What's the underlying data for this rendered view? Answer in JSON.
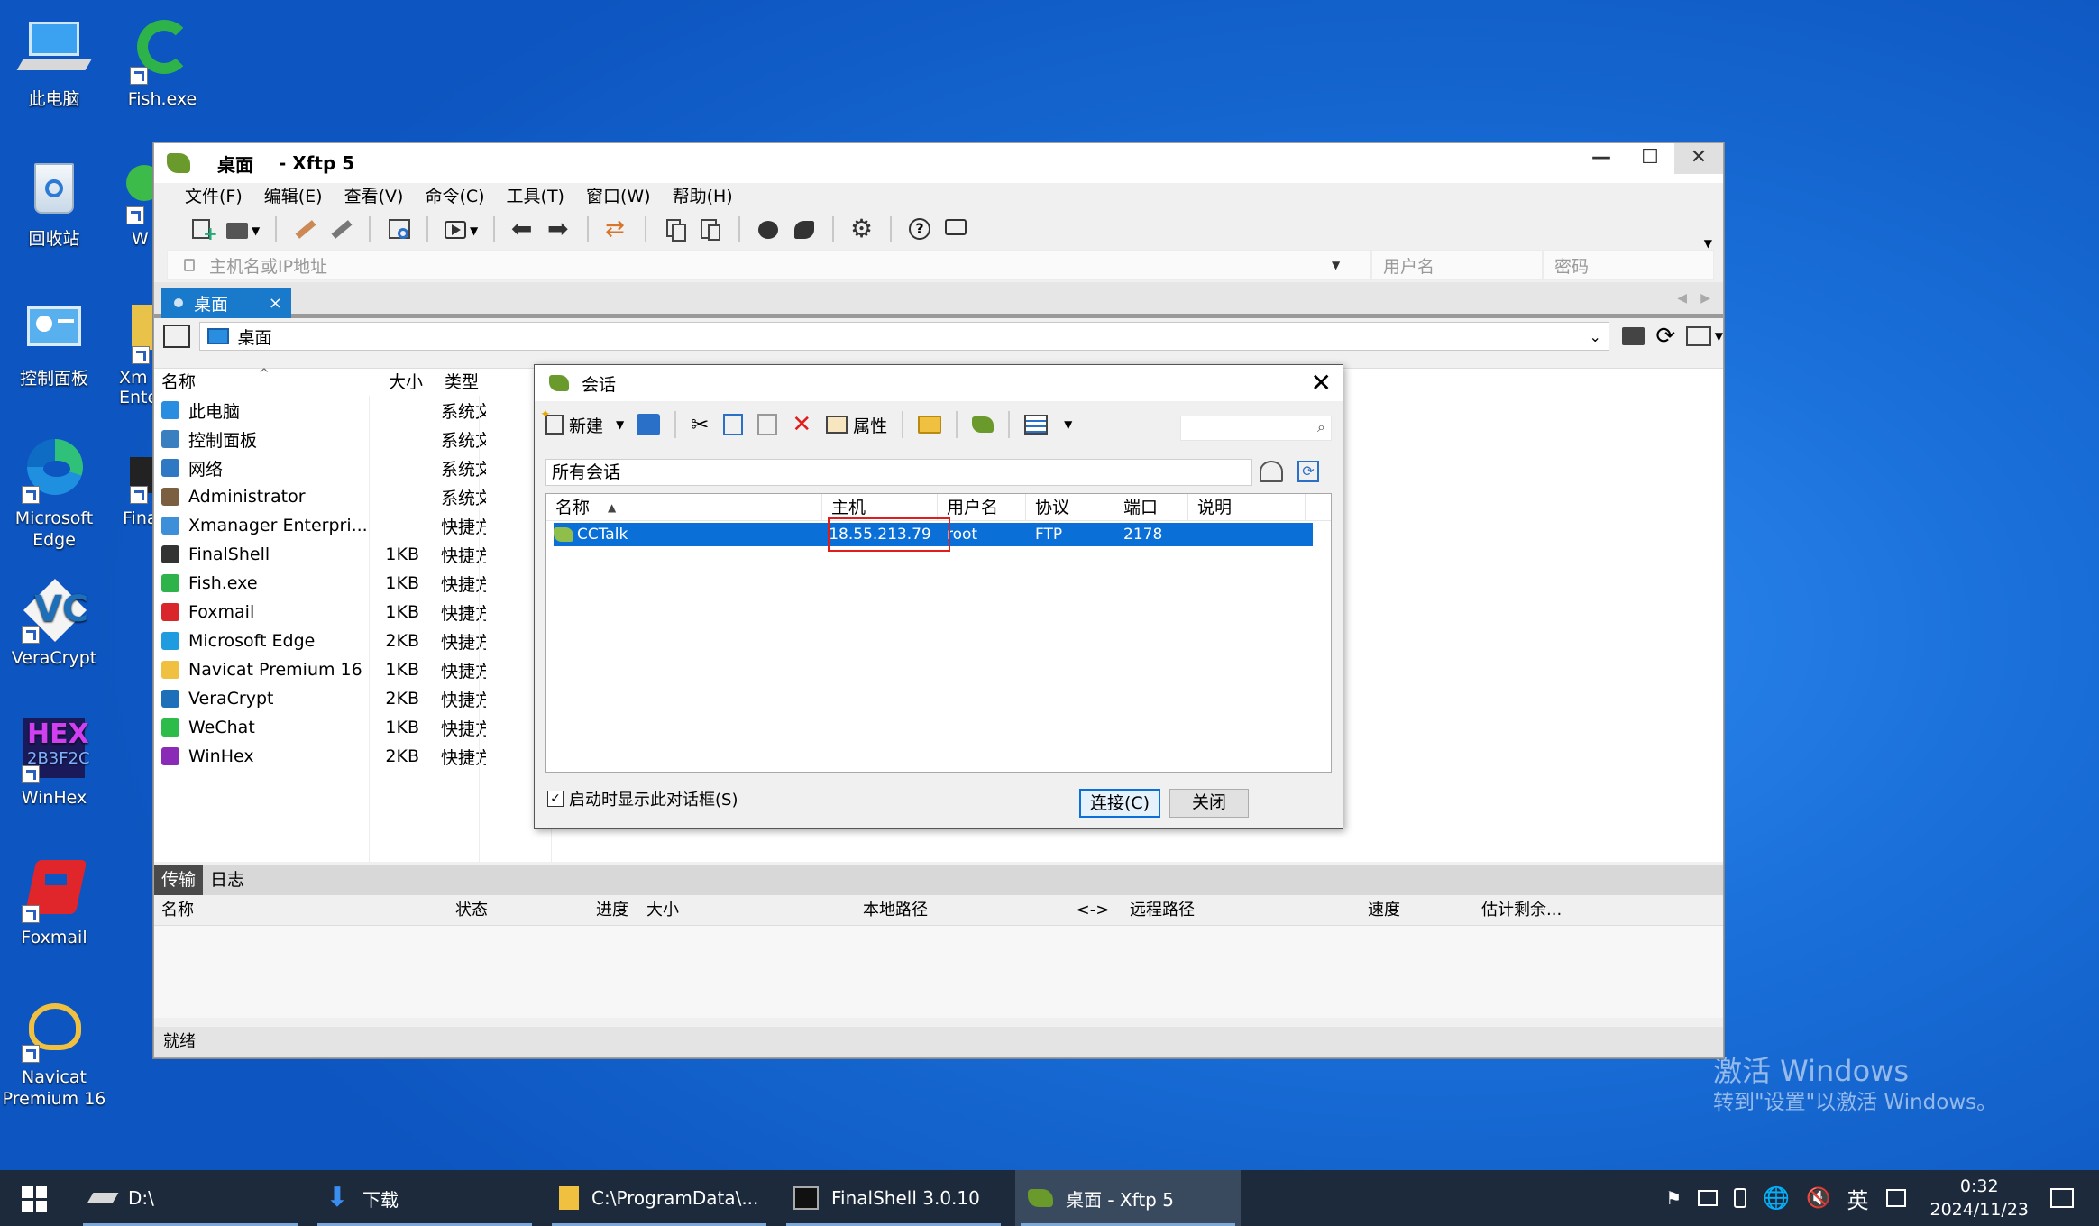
{
  "desktop": {
    "icons": [
      {
        "label": "此电脑",
        "icon": "computer-icon"
      },
      {
        "label": "Fish.exe",
        "icon": "fish-icon"
      },
      {
        "label": "回收站",
        "icon": "recycle-bin-icon"
      },
      {
        "label": "W",
        "icon": "app-icon"
      },
      {
        "label": "控制面板",
        "icon": "control-panel-icon"
      },
      {
        "label": "Xm",
        "label2": "Ente",
        "icon": "xmanager-icon"
      },
      {
        "label": "Microsoft",
        "label2": "Edge",
        "icon": "edge-icon"
      },
      {
        "label": "Fina",
        "icon": "finalshell-icon"
      },
      {
        "label": "VeraCrypt",
        "icon": "veracrypt-icon"
      },
      {
        "label": "WinHex",
        "icon": "winhex-icon"
      },
      {
        "label": "Foxmail",
        "icon": "foxmail-icon"
      },
      {
        "label": "Navicat",
        "label2": "Premium 16",
        "icon": "navicat-icon"
      }
    ],
    "watermark_line1": "激活 Windows",
    "watermark_line2": "转到\"设置\"以激活 Windows。"
  },
  "xftp": {
    "title": "桌面",
    "app": "- Xftp 5",
    "menu": [
      "文件(F)",
      "编辑(E)",
      "查看(V)",
      "命令(C)",
      "工具(T)",
      "窗口(W)",
      "帮助(H)"
    ],
    "host_placeholder": "主机名或IP地址",
    "user_placeholder": "用户名",
    "pwd_placeholder": "密码",
    "tab": "桌面",
    "tab_close": "×",
    "path": "桌面",
    "columns": {
      "name": "名称",
      "size": "大小",
      "type": "类型"
    },
    "files": [
      {
        "name": "此电脑",
        "size": "",
        "type": "系统文",
        "color": "#2a8ee0"
      },
      {
        "name": "控制面板",
        "size": "",
        "type": "系统文",
        "color": "#3a7fc0"
      },
      {
        "name": "网络",
        "size": "",
        "type": "系统文",
        "color": "#2f78c4"
      },
      {
        "name": "Administrator",
        "size": "",
        "type": "系统文",
        "color": "#7a6040"
      },
      {
        "name": "Xmanager Enterpri...",
        "size": "",
        "type": "快捷方",
        "color": "#3c8fd8"
      },
      {
        "name": "FinalShell",
        "size": "1KB",
        "type": "快捷方",
        "color": "#333333"
      },
      {
        "name": "Fish.exe",
        "size": "1KB",
        "type": "快捷方",
        "color": "#2db34a"
      },
      {
        "name": "Foxmail",
        "size": "1KB",
        "type": "快捷方",
        "color": "#d8262a"
      },
      {
        "name": "Microsoft Edge",
        "size": "2KB",
        "type": "快捷方",
        "color": "#1f9be0"
      },
      {
        "name": "Navicat Premium 16",
        "size": "1KB",
        "type": "快捷方",
        "color": "#f0c040"
      },
      {
        "name": "VeraCrypt",
        "size": "2KB",
        "type": "快捷方",
        "color": "#1c6fb8"
      },
      {
        "name": "WeChat",
        "size": "1KB",
        "type": "快捷方",
        "color": "#2dbb4a"
      },
      {
        "name": "WinHex",
        "size": "2KB",
        "type": "快捷方",
        "color": "#8a2bb8"
      }
    ],
    "transfer_tabs": [
      "传输",
      "日志"
    ],
    "transfer_cols": [
      "名称",
      "状态",
      "进度",
      "大小",
      "本地路径",
      "<->",
      "远程路径",
      "速度",
      "估计剩余..."
    ],
    "status": "就绪"
  },
  "session": {
    "title": "会话",
    "new_label": "新建",
    "props_label": "属性",
    "path": "所有会话",
    "cols": [
      "名称",
      "主机",
      "用户名",
      "协议",
      "端口",
      "说明"
    ],
    "row": {
      "name": "CCTalk",
      "host": "18.55.213.79",
      "user": "root",
      "proto": "FTP",
      "port": "2178",
      "desc": ""
    },
    "startup_check": "启动时显示此对话框(S)",
    "connect": "连接(C)",
    "close": "关闭"
  },
  "taskbar": {
    "items": [
      {
        "label": "D:\\",
        "icon": "drive-icon"
      },
      {
        "label": "下载",
        "icon": "download-icon"
      },
      {
        "label": "C:\\ProgramData\\...",
        "icon": "folder-icon"
      },
      {
        "label": "FinalShell 3.0.10",
        "icon": "finalshell-icon"
      },
      {
        "label": "桌面 - Xftp 5",
        "icon": "xftp-icon"
      }
    ],
    "ime": "英",
    "time": "0:32",
    "date": "2024/11/23"
  }
}
